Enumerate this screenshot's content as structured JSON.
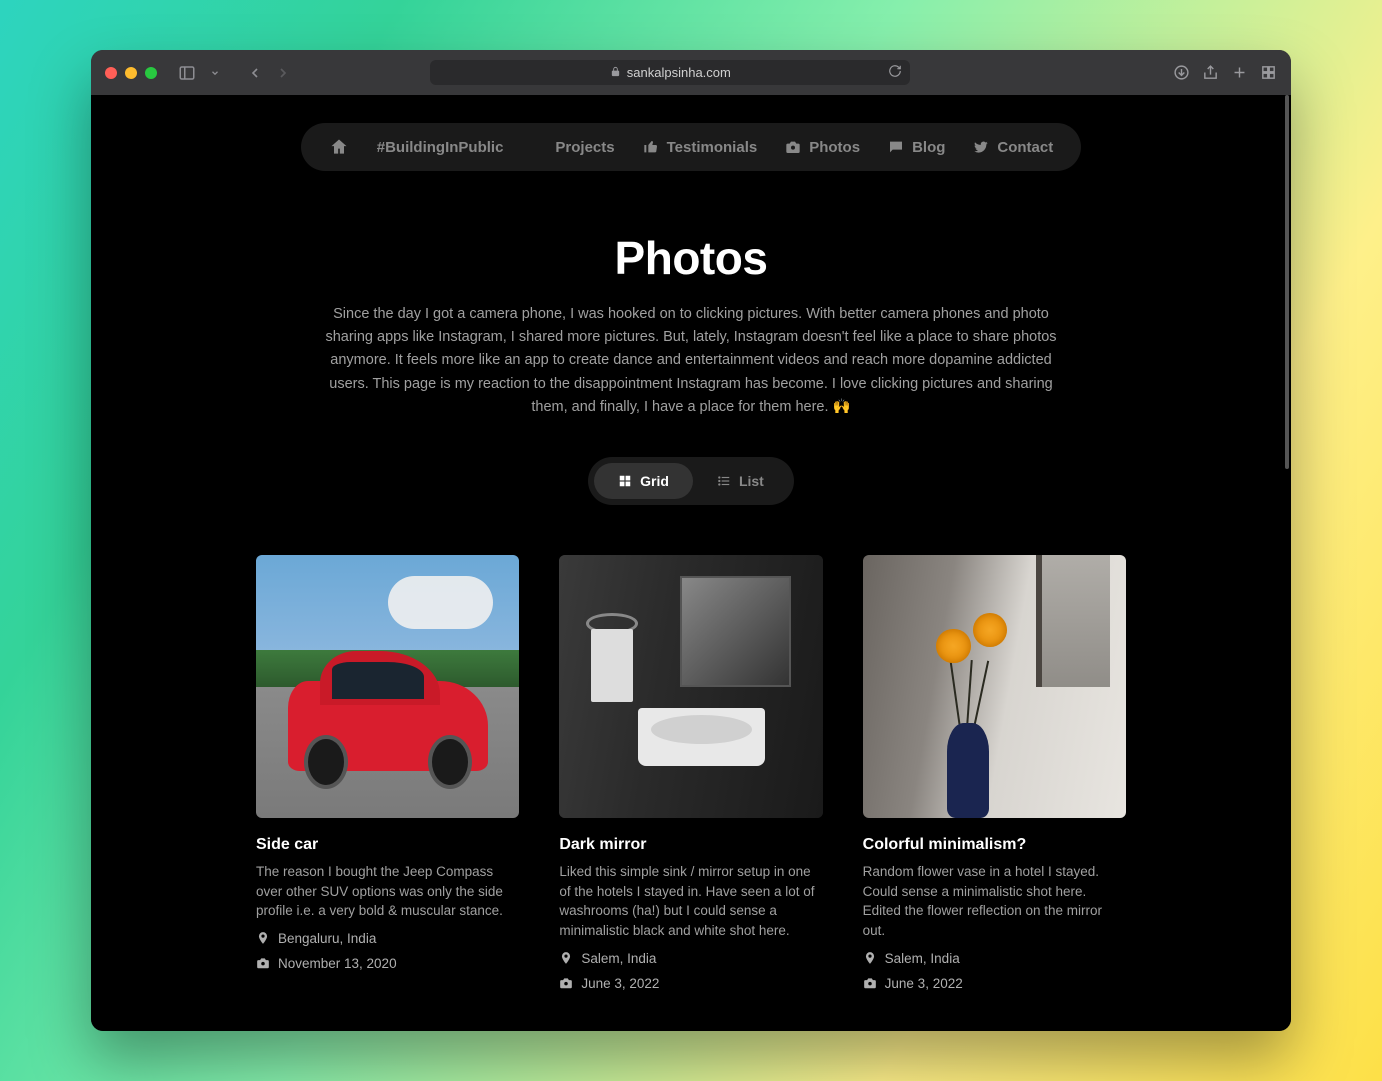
{
  "browser": {
    "url": "sankalpsinha.com"
  },
  "nav": {
    "building": "#BuildingInPublic",
    "projects": "Projects",
    "testimonials": "Testimonials",
    "photos": "Photos",
    "blog": "Blog",
    "contact": "Contact"
  },
  "page": {
    "title": "Photos",
    "intro": "Since the day I got a camera phone, I was hooked on to clicking pictures. With better camera phones and photo sharing apps like Instagram, I shared more pictures. But, lately, Instagram doesn't feel like a place to share photos anymore. It feels more like an app to create dance and entertainment videos and reach more dopamine addicted users. This page is my reaction to the disappointment Instagram has become. I love clicking pictures and sharing them, and finally, I have a place for them here. 🙌"
  },
  "toggle": {
    "grid": "Grid",
    "list": "List"
  },
  "photos": [
    {
      "title": "Side car",
      "desc": "The reason I bought the Jeep Compass over other SUV options was only the side profile i.e. a very bold & muscular stance.",
      "location": "Bengaluru, India",
      "date": "November 13, 2020"
    },
    {
      "title": "Dark mirror",
      "desc": "Liked this simple sink / mirror setup in one of the hotels I stayed in. Have seen a lot of washrooms (ha!) but I could sense a minimalistic black and white shot here.",
      "location": "Salem, India",
      "date": "June 3, 2022"
    },
    {
      "title": "Colorful minimalism?",
      "desc": "Random flower vase in a hotel I stayed. Could sense a minimalistic shot here. Edited the flower reflection on the mirror out.",
      "location": "Salem, India",
      "date": "June 3, 2022"
    }
  ]
}
